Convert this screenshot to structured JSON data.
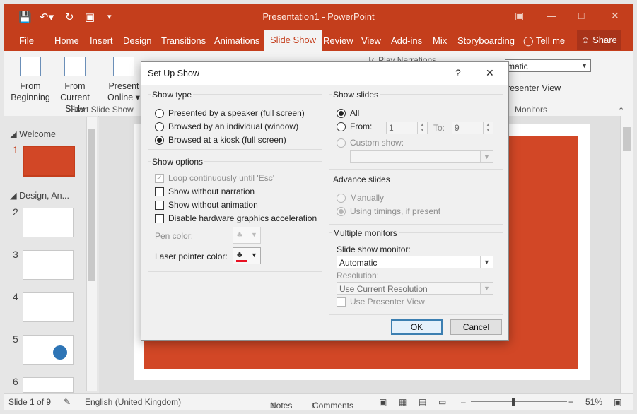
{
  "app": {
    "title": "Presentation1 - PowerPoint",
    "tabs": [
      "File",
      "Home",
      "Insert",
      "Design",
      "Transitions",
      "Animations",
      "Slide Show",
      "Review",
      "View",
      "Add-ins",
      "Mix",
      "Storyboarding"
    ],
    "tell_me": "Tell me",
    "share": "Share"
  },
  "ribbon": {
    "from_beginning": [
      "From",
      "Beginning"
    ],
    "from_current": [
      "From",
      "Current Slide"
    ],
    "present_online": [
      "Present",
      "Online"
    ],
    "play_narrations": "Play Narrations",
    "monitor_value": "matic",
    "presenter_view": "resenter View",
    "group_start": "Start Slide Show",
    "group_monitors": "Monitors"
  },
  "slides_pane": {
    "sections": [
      "Welcome",
      "Design, An..."
    ],
    "numbers": [
      "1",
      "2",
      "3",
      "4",
      "5",
      "6"
    ]
  },
  "statusbar": {
    "slide_info": "Slide 1 of 9",
    "language": "English (United Kingdom)",
    "notes": "Notes",
    "comments": "Comments",
    "zoom": "51%"
  },
  "dialog": {
    "title": "Set Up Show",
    "help": "?",
    "close": "✕",
    "show_type": {
      "title": "Show type",
      "opt1": "Presented by a speaker (full screen)",
      "opt2": "Browsed by an individual (window)",
      "opt3": "Browsed at a kiosk (full screen)",
      "selected": 3
    },
    "show_options": {
      "title": "Show options",
      "loop": "Loop continuously until 'Esc'",
      "no_narration": "Show without narration",
      "no_animation": "Show without animation",
      "disable_hw": "Disable hardware graphics acceleration",
      "pen_color": "Pen color:",
      "laser_color": "Laser pointer color:"
    },
    "show_slides": {
      "title": "Show slides",
      "all": "All",
      "from": "From:",
      "from_value": "1",
      "to": "To:",
      "to_value": "9",
      "custom": "Custom show:"
    },
    "advance": {
      "title": "Advance slides",
      "manual": "Manually",
      "timings": "Using timings, if present"
    },
    "monitors": {
      "title": "Multiple monitors",
      "monitor_label": "Slide show monitor:",
      "monitor_value": "Automatic",
      "resolution_label": "Resolution:",
      "resolution_value": "Use Current Resolution",
      "presenter_view": "Use Presenter View"
    },
    "ok": "OK",
    "cancel": "Cancel"
  },
  "colors": {
    "accent": "#c43e1c",
    "slide": "#d24726",
    "laser": "#e81123"
  }
}
